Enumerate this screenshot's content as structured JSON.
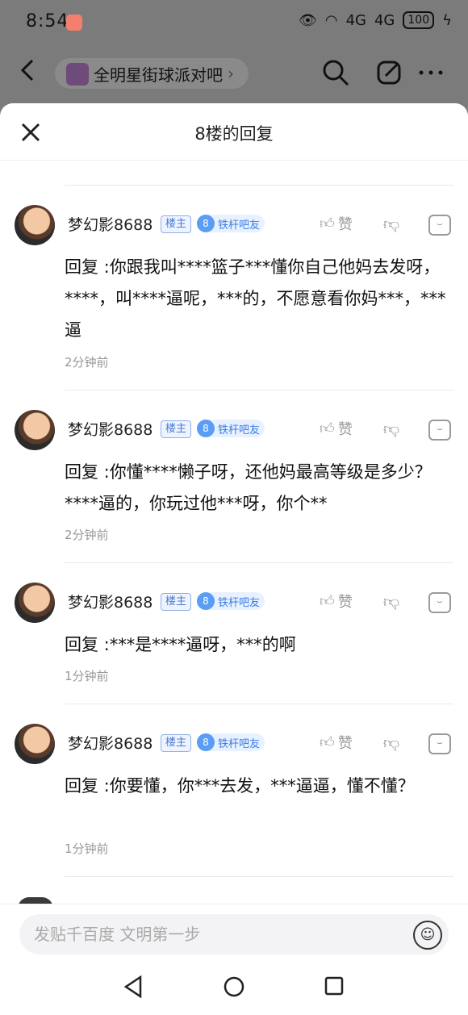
{
  "status_bar": {
    "time": "8:54",
    "signal_1": "4G",
    "signal_2": "4G",
    "battery": "100"
  },
  "header": {
    "forum_name": "全明星街球派对吧"
  },
  "sheet": {
    "title": "8楼的回复"
  },
  "replies": [
    {
      "username": "梦幻影8688",
      "owner_badge": "楼主",
      "level": "8",
      "level_title": "铁杆吧友",
      "like_label": "赞",
      "text": "回复  :你跟我叫****篮子***懂你自己他妈去发呀，****，叫****逼呢，***的，不愿意看你妈***，***逼",
      "time": "2分钟前"
    },
    {
      "username": "梦幻影8688",
      "owner_badge": "楼主",
      "level": "8",
      "level_title": "铁杆吧友",
      "like_label": "赞",
      "text": "回复  :你懂****懒子呀，还他妈最高等级是多少？****逼的，你玩过他***呀，你个**",
      "time": "2分钟前"
    },
    {
      "username": "梦幻影8688",
      "owner_badge": "楼主",
      "level": "8",
      "level_title": "铁杆吧友",
      "like_label": "赞",
      "text": "回复  :***是****逼呀，***的啊",
      "time": "1分钟前"
    },
    {
      "username": "梦幻影8688",
      "owner_badge": "楼主",
      "level": "8",
      "level_title": "铁杆吧友",
      "like_label": "赞",
      "text": "回复  :你要懂，你***去发，***逼逼，懂不懂？",
      "time": "1分钟前"
    }
  ],
  "input": {
    "placeholder": "发贴千百度 文明第一步"
  },
  "icons": {
    "back": "chevron-left-icon",
    "search": "search-icon",
    "share": "share-icon",
    "more": "more-icon",
    "close": "close-icon",
    "like": "thumbs-up-icon",
    "dislike": "thumbs-down-icon",
    "reply": "reply-icon",
    "emoji": "emoji-icon"
  }
}
